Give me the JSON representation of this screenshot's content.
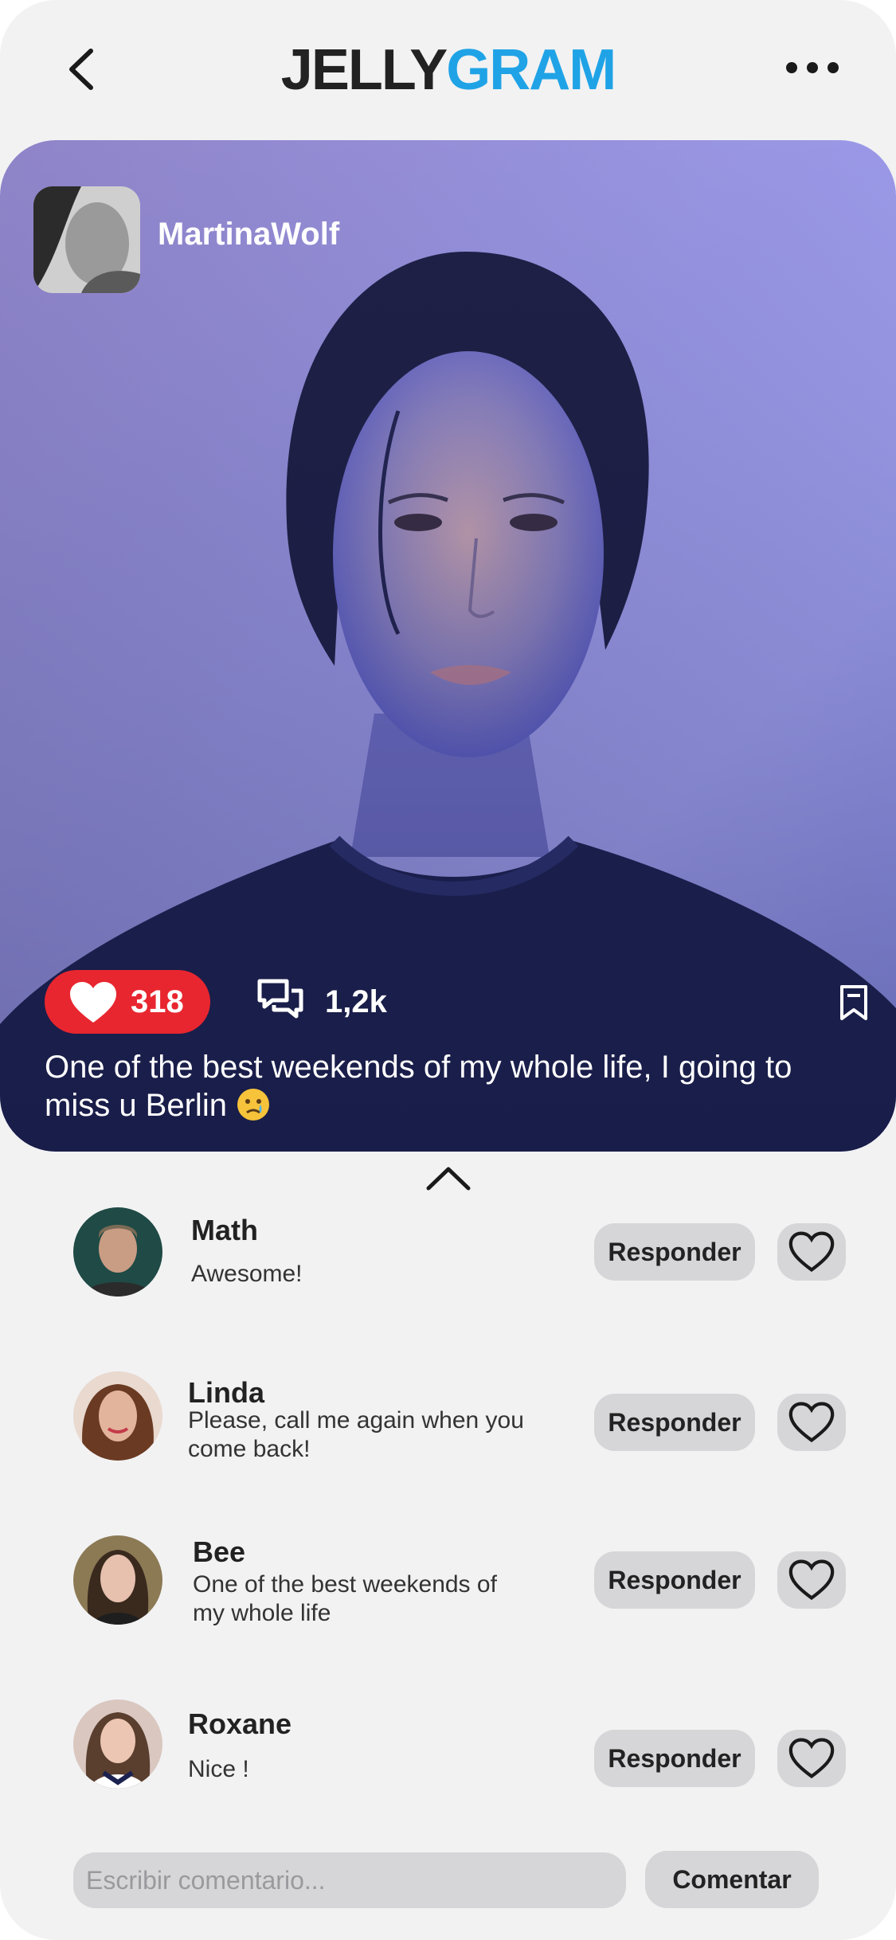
{
  "header": {
    "logo_part1": "JELLY",
    "logo_part2": "GRAM",
    "back_icon": "chevron-left-icon",
    "more_icon": "more-horizontal-icon"
  },
  "post": {
    "author": "MartinaWolf",
    "likes": "318",
    "comments": "1,2k",
    "caption": "One of the best weekends of my whole life, I going to miss u Berlin",
    "caption_emoji": "crying-face-emoji",
    "like_color": "#e8262f"
  },
  "comments": [
    {
      "name": "Math",
      "text": "Awesome!",
      "reply_label": "Responder"
    },
    {
      "name": "Linda",
      "text": "Please, call me again when you come back!",
      "reply_label": "Responder"
    },
    {
      "name": "Bee",
      "text": "One of the best weekends of my whole life",
      "reply_label": "Responder"
    },
    {
      "name": "Roxane",
      "text": "Nice !",
      "reply_label": "Responder"
    }
  ],
  "composer": {
    "placeholder": "Escribir comentario...",
    "submit_label": "Comentar"
  },
  "colors": {
    "brand_dark": "#222222",
    "brand_accent": "#1fa3e6",
    "background": "#f2f2f3",
    "button_bg": "#d6d6d8"
  }
}
